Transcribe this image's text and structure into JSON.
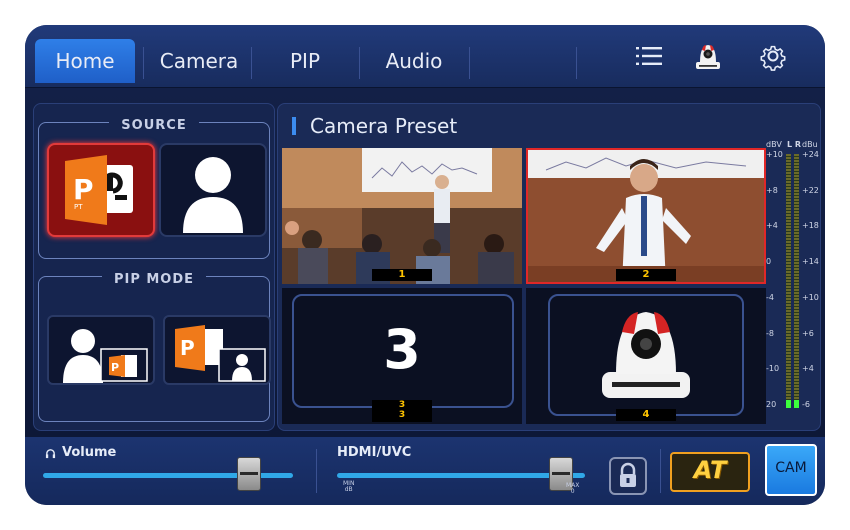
{
  "tabs": [
    {
      "label": "Home",
      "active": true
    },
    {
      "label": "Camera",
      "active": false
    },
    {
      "label": "PIP",
      "active": false
    },
    {
      "label": "Audio",
      "active": false
    }
  ],
  "toolbar_icons": [
    "list-icon",
    "ptz-camera-icon",
    "gear-icon"
  ],
  "source": {
    "title": "SOURCE",
    "items": [
      {
        "name": "powerpoint-icon",
        "selected": true
      },
      {
        "name": "person-icon",
        "selected": false
      }
    ]
  },
  "pip_mode": {
    "title": "PIP MODE",
    "items": [
      "person-with-ppt-pip-icon",
      "ppt-with-person-pip-icon"
    ]
  },
  "preset_panel": {
    "title": "Camera Preset",
    "presets": [
      {
        "number": "1",
        "selected": false
      },
      {
        "number": "2",
        "selected": true
      },
      {
        "number": "3",
        "big_label": "3",
        "label_lines": [
          "3",
          "3"
        ],
        "selected": false
      },
      {
        "number": "4",
        "selected": false
      }
    ]
  },
  "meter": {
    "header_left": "dBV",
    "header_channels": "L R",
    "header_right": "dBu",
    "left_scale": [
      "+10",
      "+8",
      "+4",
      "0",
      "-4",
      "-8",
      "-10",
      "20"
    ],
    "right_scale": [
      "+24",
      "+22",
      "+18",
      "+14",
      "+10",
      "+6",
      "+4",
      "-6"
    ],
    "level_fraction": 0.03
  },
  "bottom": {
    "volume_label": "Volume",
    "volume_level": 0.82,
    "hdmi_label": "HDMI/UVC",
    "hdmi_level": 0.9,
    "hdmi_min_label": "MIN",
    "hdmi_min_value": "dB",
    "hdmi_max_label": "MAX",
    "hdmi_max_value": "0",
    "at_label": "AT",
    "cam_label": "CAM"
  },
  "colors": {
    "accent": "#2f7fe8",
    "selected": "#e02828",
    "label": "#ffc400",
    "at_orange": "#f0a020"
  }
}
